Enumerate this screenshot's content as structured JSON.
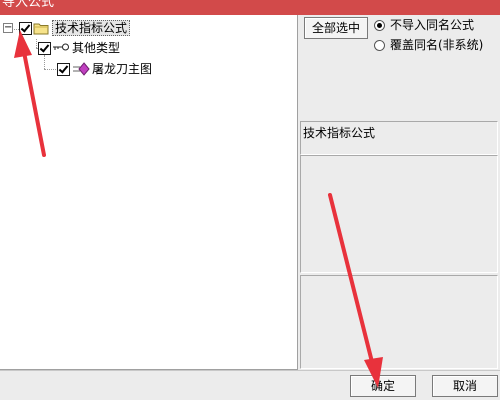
{
  "window": {
    "title": "导入公式"
  },
  "tree": {
    "root": {
      "expander": "−",
      "label": "技术指标公式",
      "checked": true
    },
    "category": {
      "label": "其他类型",
      "checked": true
    },
    "item": {
      "label": "屠龙刀主图",
      "checked": true
    }
  },
  "controls": {
    "select_all_label": "全部选中",
    "radio_no_import": "不导入同名公式",
    "radio_overwrite": "覆盖同名(非系统)",
    "selected_radio": "radio_no_import"
  },
  "info": {
    "selected_name": "技术指标公式"
  },
  "footer": {
    "ok_label": "确定",
    "cancel_label": "取消"
  },
  "colors": {
    "titlebar": "#d24a4a",
    "annotation_arrow": "#e8323c"
  }
}
